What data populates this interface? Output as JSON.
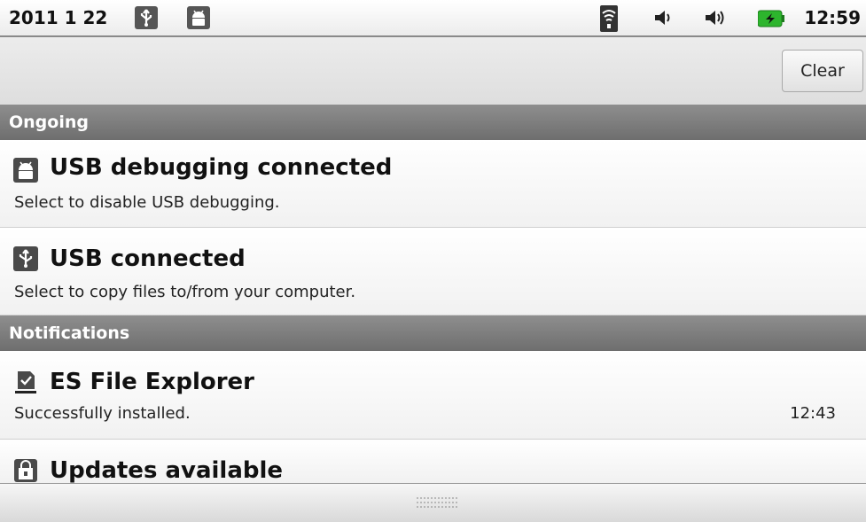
{
  "status_bar": {
    "date": "2011 1 22",
    "time": "12:59",
    "icons": [
      "usb-icon",
      "android-debug-icon",
      "wifi-icon",
      "volume-icon",
      "volume-icon",
      "battery-charging-icon"
    ],
    "battery_color": "#2db52d"
  },
  "toolbar": {
    "clear_label": "Clear"
  },
  "sections": {
    "ongoing_label": "Ongoing",
    "notifications_label": "Notifications"
  },
  "ongoing": [
    {
      "title": "USB debugging connected",
      "subtitle": "Select to disable USB debugging.",
      "icon": "android-debug-icon"
    },
    {
      "title": "USB connected",
      "subtitle": "Select to copy files to/from your computer.",
      "icon": "usb-icon"
    }
  ],
  "notifications": [
    {
      "title": "ES File Explorer",
      "subtitle": "Successfully installed.",
      "time": "12:43",
      "icon": "install-complete-icon"
    },
    {
      "title": "Updates available",
      "icon": "market-bag-icon"
    }
  ]
}
